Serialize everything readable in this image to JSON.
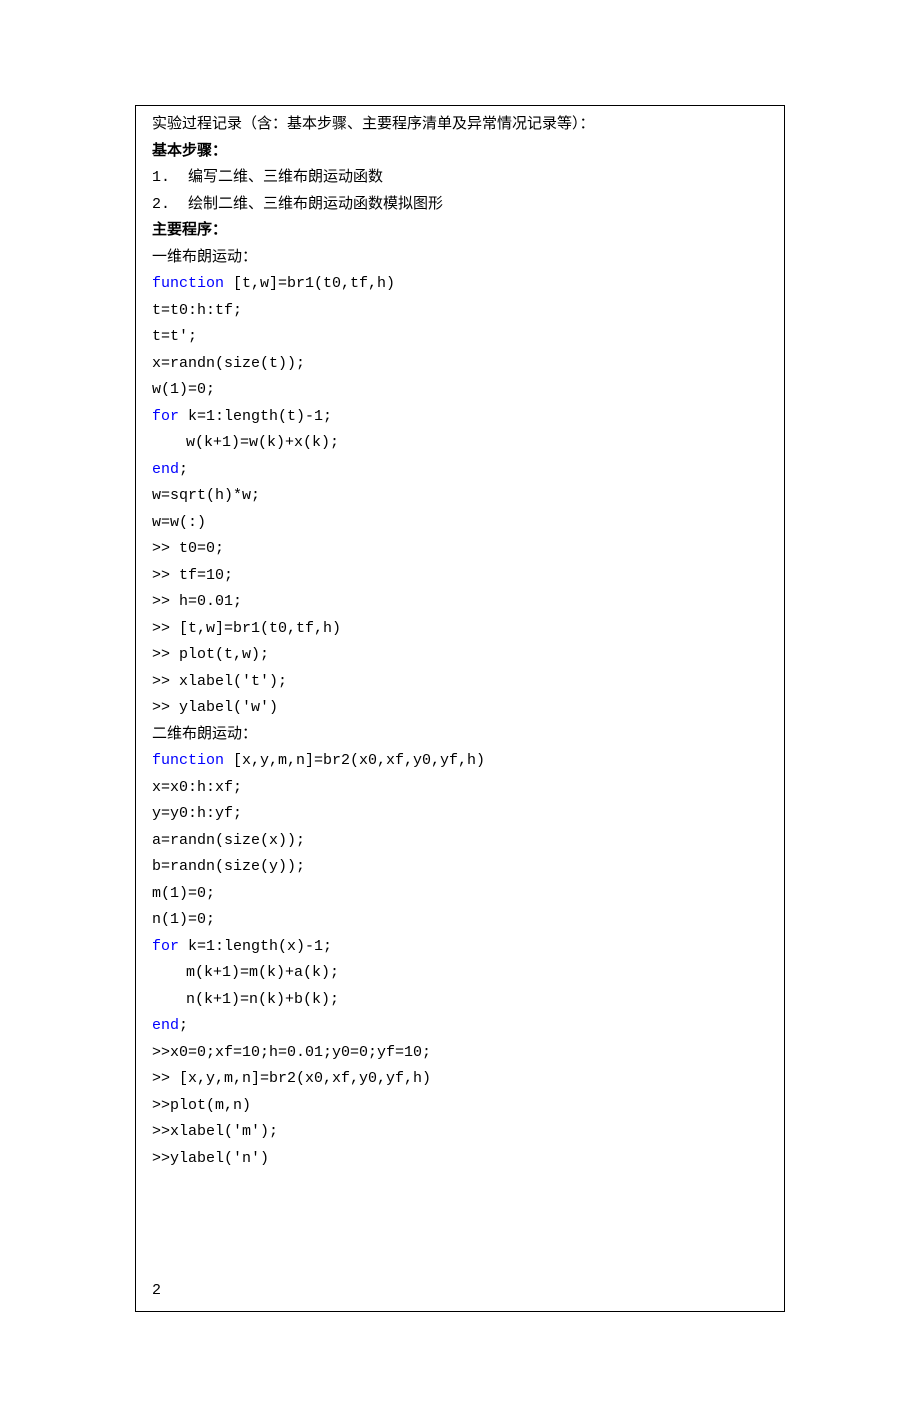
{
  "title": "实验过程记录（含：基本步骤、主要程序清单及异常情况记录等）：",
  "sectionSteps": "基本步骤：",
  "step1": "1.  编写二维、三维布朗运动函数",
  "step2": "2.  绘制二维、三维布朗运动函数模拟图形",
  "sectionPrograms": "主要程序：",
  "prog1_title": "一维布朗运动：",
  "p1_kw1": "function",
  "p1_l1_rest": " [t,w]=br1(t0,tf,h)",
  "p1_l2": "t=t0:h:tf;",
  "p1_l3": "t=t';",
  "p1_l4": "x=randn(size(t));",
  "p1_l5": "w(1)=0;",
  "p1_kw2": "for",
  "p1_l6_rest": " k=1:length(t)-1;",
  "p1_l7": "w(k+1)=w(k)+x(k);",
  "p1_kw3": "end",
  "p1_l8_rest": ";",
  "p1_l9": "w=sqrt(h)*w;",
  "p1_l10": "w=w(:)",
  "p1_l11": ">> t0=0;",
  "p1_l12": ">> tf=10;",
  "p1_l13": ">> h=0.01;",
  "p1_l14": ">> [t,w]=br1(t0,tf,h)",
  "p1_l15": ">> plot(t,w);",
  "p1_l16": ">> xlabel('t');",
  "p1_l17": ">> ylabel('w')",
  "prog2_title": "二维布朗运动：",
  "p2_kw1": "function",
  "p2_l1_rest": " [x,y,m,n]=br2(x0,xf,y0,yf,h)",
  "p2_l2": "x=x0:h:xf;",
  "p2_l3": "y=y0:h:yf;",
  "p2_l4": "a=randn(size(x));",
  "p2_l5": "b=randn(size(y));",
  "p2_l6": "m(1)=0;",
  "p2_l7": "n(1)=0;",
  "p2_kw2": "for",
  "p2_l8_rest": " k=1:length(x)-1;",
  "p2_l9": "m(k+1)=m(k)+a(k);",
  "p2_l10": "n(k+1)=n(k)+b(k);",
  "p2_kw3": "end",
  "p2_l11_rest": ";",
  "p2_l12": ">>x0=0;xf=10;h=0.01;y0=0;yf=10;",
  "p2_l13": ">> [x,y,m,n]=br2(x0,xf,y0,yf,h)",
  "p2_l14": ">>plot(m,n)",
  "p2_l15": ">>xlabel('m');",
  "p2_l16": ">>ylabel('n')",
  "pageNumber": "2"
}
